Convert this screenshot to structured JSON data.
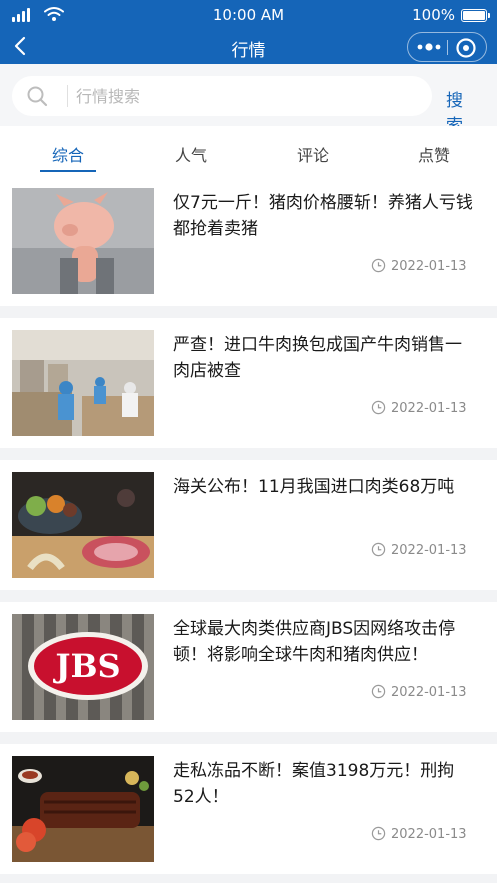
{
  "status_bar": {
    "time": "10:00 AM",
    "battery": "100%"
  },
  "nav": {
    "title": "行情"
  },
  "search": {
    "placeholder": "行情搜索",
    "value": "",
    "button_label": "搜 索"
  },
  "tabs": [
    {
      "label": "综合",
      "active": true
    },
    {
      "label": "人气",
      "active": false
    },
    {
      "label": "评论",
      "active": false
    },
    {
      "label": "点赞",
      "active": false
    }
  ],
  "accent_color": "#1565b8",
  "articles": [
    {
      "title": "仅7元一斤！猪肉价格腰斩！养猪人亏钱都抢着卖猪",
      "date": "2022-01-13"
    },
    {
      "title": "严查！进口牛肉换包成国产牛肉销售一肉店被查",
      "date": "2022-01-13"
    },
    {
      "title": "海关公布！11月我国进口肉类68万吨",
      "date": "2022-01-13"
    },
    {
      "title": "全球最大肉类供应商JBS因网络攻击停顿！将影响全球牛肉和猪肉供应！",
      "date": "2022-01-13"
    },
    {
      "title": "走私冻品不断！案值3198万元！刑拘52人！",
      "date": "2022-01-13"
    }
  ],
  "thumb_logo_text": "JBS"
}
